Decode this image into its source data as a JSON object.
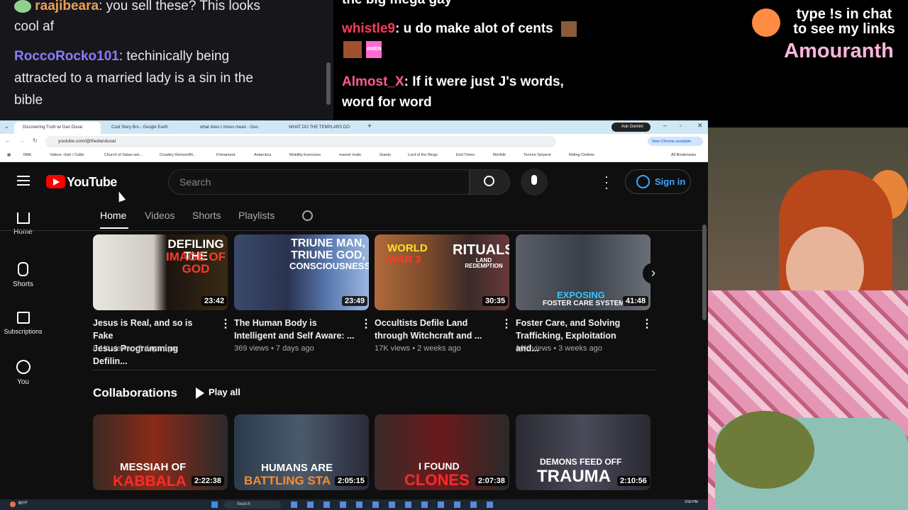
{
  "chat_left": {
    "messages": [
      {
        "user": "raajibeara",
        "text": ": you sell these? This looks",
        "cont": "cool af",
        "color": "#e8a05a"
      },
      {
        "user": "RoccoRocko101",
        "text": ": techinically being",
        "cont": "attracted to a married lady is a sin in the",
        "cont2": "bible",
        "color": "#8a7cff"
      }
    ]
  },
  "chat_right": {
    "top_partial": "the big mega gay",
    "messages": [
      {
        "user": "whistle9",
        "text": ": u do make alot of cents",
        "color": "#ff3b5c",
        "emote_label": "AMEN"
      },
      {
        "user": "Almost_X",
        "text": ": If it were just J's words,",
        "cont": "word for word",
        "color": "#ff5c8a"
      }
    ]
  },
  "overlay": {
    "line1": "type !s in chat",
    "line2": "to see my links",
    "name": "Amouranth"
  },
  "browser": {
    "tabs": [
      {
        "label": "Discovering Truth w/ Dan Duval",
        "active": true
      },
      {
        "label": "Cool Story Bro - Google Earth",
        "active": false
      },
      {
        "label": "what does t minus mean - Goo",
        "active": false
      },
      {
        "label": "WHAT DO THE TEMPLARS DO",
        "active": false
      }
    ],
    "ask_gemini": "Ask Gemini",
    "url": "youtube.com/@thedanduval",
    "new_chrome": "New Chrome available",
    "bookmarks": [
      "NWL",
      "Videos -Irish / Celtic",
      "Church of Satan wei...",
      "Crowley Demon/Ali...",
      "Firmament",
      "Antarctica",
      "Mobility Exercises",
      "marvel rivals",
      "Giants",
      "Lord of the Rings",
      "End Times",
      "Merfolk",
      "Techno Serpent",
      "Riding Clothes"
    ],
    "all_bookmarks": "All Bookmarks"
  },
  "youtube": {
    "logo": "YouTube",
    "search_placeholder": "Search",
    "sign_in": "Sign in",
    "sidebar": [
      {
        "label": "Home",
        "icon": "home-icon"
      },
      {
        "label": "Shorts",
        "icon": "shorts-icon"
      },
      {
        "label": "Subscriptions",
        "icon": "subscriptions-icon"
      },
      {
        "label": "You",
        "icon": "you-icon"
      }
    ],
    "channel_tabs": [
      "Home",
      "Videos",
      "Shorts",
      "Playlists"
    ],
    "videos": [
      {
        "title1": "Jesus is Real, and so is Fake",
        "title2": "Jesus Programming Defilin...",
        "views": "8.1K views",
        "age": "7 days ago",
        "duration": "23:42",
        "thumb_text1": "DEFILING THE",
        "thumb_text2": "IMAGE OF GOD"
      },
      {
        "title1": "The Human Body is",
        "title2": "Intelligent and Self Aware: ...",
        "views": "369 views",
        "age": "7 days ago",
        "duration": "23:49",
        "thumb_text1": "TRIUNE MAN,",
        "thumb_text2": "TRIUNE GOD,",
        "thumb_text3": "CONSCIOUSNESS"
      },
      {
        "title1": "Occultists Defile Land",
        "title2": "through Witchcraft and ...",
        "views": "17K views",
        "age": "2 weeks ago",
        "duration": "30:35",
        "thumb_text1": "WORLD",
        "thumb_text2": "WAR 3",
        "thumb_text3": "RITUALS",
        "thumb_text4": "LAND REDEMPTION"
      },
      {
        "title1": "Foster Care, and Solving",
        "title2": "Trafficking, Exploitation and...",
        "views": "10K views",
        "age": "3 weeks ago",
        "duration": "41:48",
        "thumb_text1": "EXPOSING",
        "thumb_text2": "FOSTER CARE SYSTEMS"
      }
    ],
    "collab_title": "Collaborations",
    "play_all": "Play all",
    "collabs": [
      {
        "duration": "2:22:38",
        "t1": "MESSIAH OF",
        "t2": "KABBALA"
      },
      {
        "duration": "2:05:15",
        "t1": "HUMANS ARE",
        "t2": "BATTLING STA"
      },
      {
        "duration": "2:07:38",
        "t1": "I FOUND",
        "t2": "CLONES"
      },
      {
        "duration": "2:10:56",
        "t1": "DEMONS FEED OFF",
        "t2": "TRAUMA"
      }
    ]
  },
  "taskbar": {
    "weather": "80°F",
    "search": "Search",
    "time": "3:56 PM"
  },
  "colors": {
    "yt_red": "#ff0000",
    "overlay_pink": "#ffb6d9",
    "signin_blue": "#3ea6ff"
  }
}
